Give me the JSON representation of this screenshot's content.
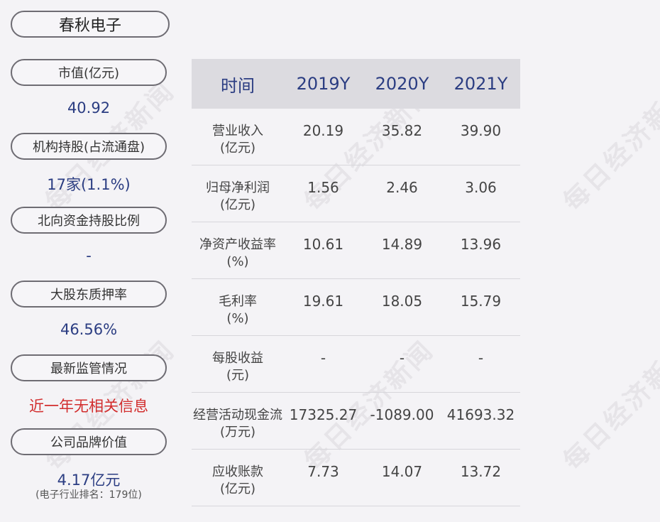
{
  "company": {
    "name": "春秋电子"
  },
  "watermark": "每日经济新闻",
  "metrics": [
    {
      "label": "市值(亿元)",
      "value": "40.92"
    },
    {
      "label": "机构持股(占流通盘)",
      "value": "17家(1.1%)"
    },
    {
      "label": "北向资金持股比例",
      "value": "-"
    },
    {
      "label": "大股东质押率",
      "value": "46.56%"
    },
    {
      "label": "最新监管情况",
      "value": "近一年无相关信息"
    },
    {
      "label": "公司品牌价值",
      "value": "4.17亿元",
      "note": "(电子行业排名：179位)"
    }
  ],
  "colors": {
    "accent": "#2b3d82",
    "alert": "#d22d2d",
    "header_bg": "#dcdbe0",
    "page_bg": "#f4f3f6"
  },
  "table": {
    "headers": [
      "时间",
      "2019Y",
      "2020Y",
      "2021Y"
    ],
    "rows": [
      {
        "label1": "营业收入",
        "label2": "(亿元)",
        "values": [
          "20.19",
          "35.82",
          "39.90"
        ]
      },
      {
        "label1": "归母净利润",
        "label2": "(亿元)",
        "values": [
          "1.56",
          "2.46",
          "3.06"
        ]
      },
      {
        "label1": "净资产收益率",
        "label2": "(%)",
        "values": [
          "10.61",
          "14.89",
          "13.96"
        ]
      },
      {
        "label1": "毛利率",
        "label2": "(%)",
        "values": [
          "19.61",
          "18.05",
          "15.79"
        ]
      },
      {
        "label1": "每股收益",
        "label2": "(元)",
        "values": [
          "-",
          "-",
          "-"
        ]
      },
      {
        "label1": "经营活动现金流",
        "label2": "(万元)",
        "values": [
          "17325.27",
          "-1089.00",
          "41693.32"
        ]
      },
      {
        "label1": "应收账款",
        "label2": "(亿元)",
        "values": [
          "7.73",
          "14.07",
          "13.72"
        ]
      }
    ]
  }
}
